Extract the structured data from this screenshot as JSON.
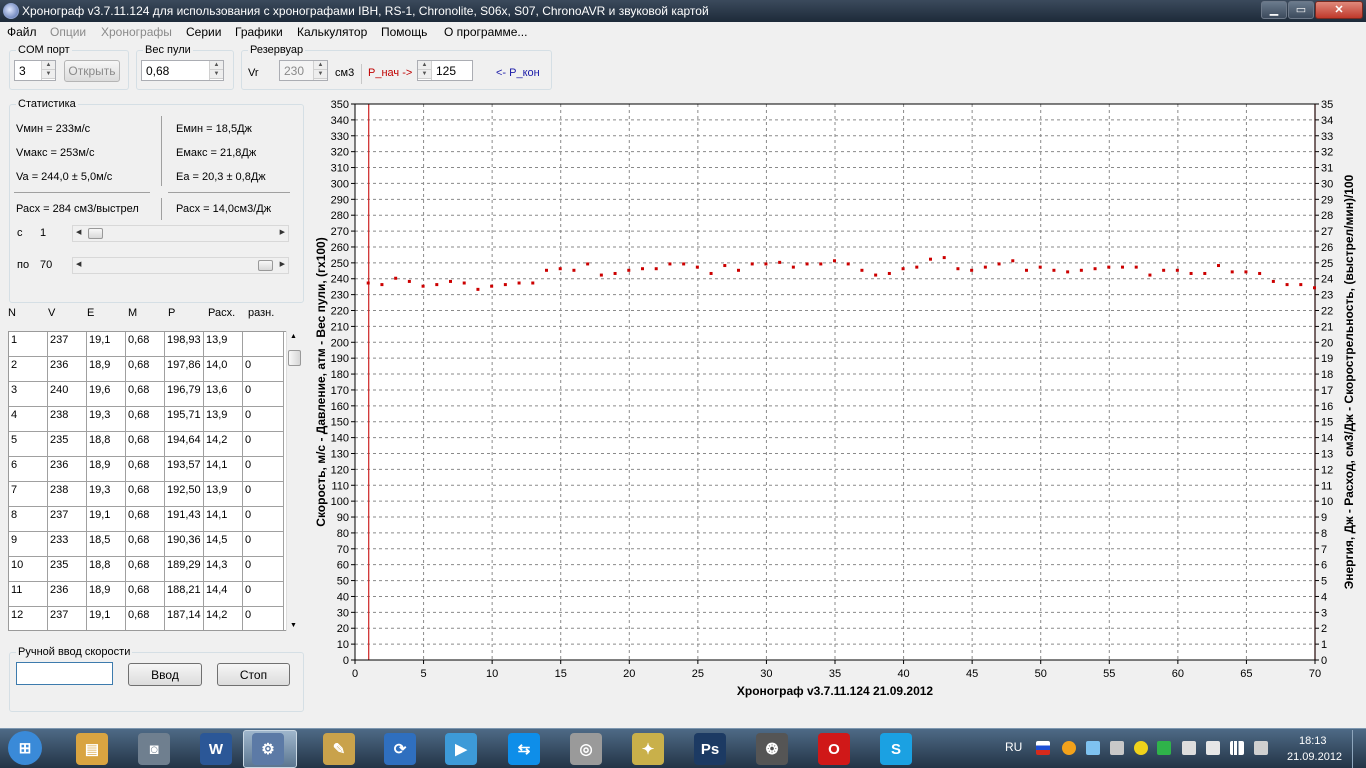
{
  "window": {
    "title": "Хронограф v3.7.11.124  для использования с хронографами  IBH, RS-1, Chronolite, S06x, S07, ChronoAVR и звуковой картой",
    "min_glyph": "▁",
    "max_glyph": "▭",
    "close_glyph": "✕"
  },
  "menu": [
    {
      "label": "Файл",
      "disabled": false
    },
    {
      "label": "Опции",
      "disabled": true
    },
    {
      "label": "Хронографы",
      "disabled": true
    },
    {
      "label": "Серии",
      "disabled": false
    },
    {
      "label": "Графики",
      "disabled": false
    },
    {
      "label": "Калькулятор",
      "disabled": false
    },
    {
      "label": "Помощь",
      "disabled": false
    },
    {
      "label": "О программе...",
      "disabled": false
    }
  ],
  "com": {
    "legend": "COM порт",
    "value": "3",
    "open_label": "Открыть"
  },
  "bullet": {
    "legend": "Вес пули",
    "value": "0,68"
  },
  "tank": {
    "legend": "Резервуар",
    "vr_label": "Vr",
    "vr_value": "230",
    "unit": "см3",
    "p_start_label": "P_нач ->",
    "p_value": "125",
    "p_end_label": "<- P_кон"
  },
  "stats": {
    "legend": "Статистика",
    "vmin": "Vмин = 233м/с",
    "vmax": "Vмакс = 253м/с",
    "va": "Va = 244,0 ± 5,0м/с",
    "emin": "Емин = 18,5Дж",
    "emax": "Емакс = 21,8Дж",
    "ea": "Ea = 20,3 ± 0,8Дж",
    "rate1": "Расх = 284 см3/выстрел",
    "rate2": "Расх = 14,0см3/Дж",
    "from_label": "с",
    "from_value": "1",
    "to_label": "по",
    "to_value": "70",
    "from_fraction": 0.0,
    "to_fraction": 1.0
  },
  "table": {
    "headers": [
      "N",
      "V",
      "E",
      "M",
      "P",
      "Расх.",
      "разн."
    ],
    "rows": [
      [
        "1",
        "237",
        "19,1",
        "0,68",
        "198,93",
        "13,9",
        ""
      ],
      [
        "2",
        "236",
        "18,9",
        "0,68",
        "197,86",
        "14,0",
        "0"
      ],
      [
        "3",
        "240",
        "19,6",
        "0,68",
        "196,79",
        "13,6",
        "0"
      ],
      [
        "4",
        "238",
        "19,3",
        "0,68",
        "195,71",
        "13,9",
        "0"
      ],
      [
        "5",
        "235",
        "18,8",
        "0,68",
        "194,64",
        "14,2",
        "0"
      ],
      [
        "6",
        "236",
        "18,9",
        "0,68",
        "193,57",
        "14,1",
        "0"
      ],
      [
        "7",
        "238",
        "19,3",
        "0,68",
        "192,50",
        "13,9",
        "0"
      ],
      [
        "8",
        "237",
        "19,1",
        "0,68",
        "191,43",
        "14,1",
        "0"
      ],
      [
        "9",
        "233",
        "18,5",
        "0,68",
        "190,36",
        "14,5",
        "0"
      ],
      [
        "10",
        "235",
        "18,8",
        "0,68",
        "189,29",
        "14,3",
        "0"
      ],
      [
        "11",
        "236",
        "18,9",
        "0,68",
        "188,21",
        "14,4",
        "0"
      ],
      [
        "12",
        "237",
        "19,1",
        "0,68",
        "187,14",
        "14,2",
        "0"
      ]
    ]
  },
  "manual": {
    "legend": "Ручной ввод скорости",
    "value": "",
    "enter_label": "Ввод",
    "stop_label": "Стоп"
  },
  "chart_data": {
    "type": "scatter",
    "title": "Хронограф v3.7.11.124       21.09.2012",
    "ylabel": "Скорость, м/с  - Давление, атм - Вес пули, (гх100)",
    "y2label": "Энергия, Дж  -  Расход, см3/Дж  - Скорострельность, (выстрел/мин)/100",
    "xlim": [
      0,
      70
    ],
    "ylim": [
      0,
      350
    ],
    "y2lim": [
      0,
      35
    ],
    "xticks": [
      0,
      5,
      10,
      15,
      20,
      25,
      30,
      35,
      40,
      45,
      50,
      55,
      60,
      65,
      70
    ],
    "yticks_step": 10,
    "y2ticks_step": 1,
    "grid": true,
    "vlines": [
      1,
      70
    ],
    "series_color": "#cc0000",
    "series": [
      {
        "x": [
          1,
          2,
          3,
          4,
          5,
          6,
          7,
          8,
          9,
          10,
          11,
          12,
          13,
          14,
          15,
          16,
          17,
          18,
          19,
          20,
          21,
          22,
          23,
          24,
          25,
          26,
          27,
          28,
          29,
          30,
          31,
          32,
          33,
          34,
          35,
          36,
          37,
          38,
          39,
          40,
          41,
          42,
          43,
          44,
          45,
          46,
          47,
          48,
          49,
          50,
          51,
          52,
          53,
          54,
          55,
          56,
          57,
          58,
          59,
          60,
          61,
          62,
          63,
          64,
          65,
          66,
          67,
          68,
          69,
          70
        ],
        "y": [
          237,
          236,
          240,
          238,
          235,
          236,
          238,
          237,
          233,
          235,
          236,
          237,
          237,
          245,
          246,
          245,
          249,
          242,
          243,
          245,
          246,
          246,
          249,
          249,
          247,
          243,
          248,
          245,
          249,
          249,
          250,
          247,
          249,
          249,
          251,
          249,
          245,
          242,
          243,
          246,
          247,
          252,
          253,
          246,
          245,
          247,
          249,
          251,
          245,
          247,
          245,
          244,
          245,
          246,
          247,
          247,
          247,
          242,
          245,
          245,
          243,
          243,
          248,
          244,
          244,
          243,
          238,
          236,
          236,
          234
        ]
      }
    ]
  },
  "taskbar": {
    "language": "RU",
    "time": "18:13",
    "date": "21.09.2012",
    "apps": [
      {
        "name": "start-orb-icon",
        "glyph": "⊞",
        "color": "#3a8ad8"
      },
      {
        "name": "explorer-icon",
        "glyph": "▤",
        "color": "#d9a441"
      },
      {
        "name": "camera-icon",
        "glyph": "◙",
        "color": "#6f7f8f"
      },
      {
        "name": "word-icon",
        "glyph": "W",
        "color": "#2b5797"
      },
      {
        "name": "chronograph-app-icon",
        "glyph": "⚙",
        "color": "#5c7aa6"
      },
      {
        "name": "notepad-icon",
        "glyph": "✎",
        "color": "#c9a24b"
      },
      {
        "name": "sync-icon",
        "glyph": "⟳",
        "color": "#2f6fbf"
      },
      {
        "name": "media-player-icon",
        "glyph": "▶",
        "color": "#3d9ad8"
      },
      {
        "name": "teamviewer-icon",
        "glyph": "⇆",
        "color": "#0e8ee9"
      },
      {
        "name": "disc-icon",
        "glyph": "◎",
        "color": "#9a9a9a"
      },
      {
        "name": "winamp-icon",
        "glyph": "✦",
        "color": "#c9b04a"
      },
      {
        "name": "photoshop-icon",
        "glyph": "Ps",
        "color": "#1c3a63"
      },
      {
        "name": "camera-aperture-icon",
        "glyph": "❂",
        "color": "#555"
      },
      {
        "name": "opera-icon",
        "glyph": "O",
        "color": "#d01818"
      },
      {
        "name": "skype-icon",
        "glyph": "S",
        "color": "#1ba1e2"
      }
    ]
  }
}
